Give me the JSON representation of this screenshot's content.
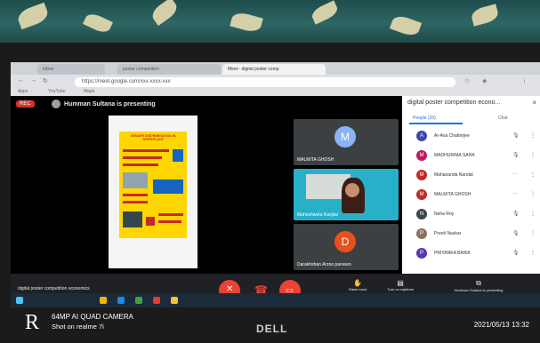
{
  "browser": {
    "tabs": [
      "Inbox",
      "poster competition",
      "Meet - digital poster comp"
    ],
    "address": "https://meet.google.com/xxx-xxxx-xxx",
    "bookmarks": [
      "Apps",
      "YouTube",
      "Maps"
    ]
  },
  "meet": {
    "rec_label": "REC",
    "presenting_text": "Humman Sultana is presenting",
    "meeting_name": "digital poster competition economics",
    "poster": {
      "title": "GENDER DISCRIMINATION IN WORKPLACE"
    },
    "tiles": [
      {
        "name": "MALMITA GHOSH",
        "initial": "M",
        "color": "#8ab4f8"
      },
      {
        "name": "Maheshweta Kanjilal",
        "video": true
      },
      {
        "name": "Darakhshan Arzoo parveen",
        "initial": "D",
        "color": "#e8501c"
      }
    ],
    "controls": {
      "mic_icon": "mic-off-icon",
      "end_icon": "call-end-icon",
      "cam_icon": "camera-off-icon",
      "raise_hand": "Raise hand",
      "captions": "Turn on captions",
      "present": "Humman Sultana is presenting"
    }
  },
  "sidebar": {
    "title": "digital poster competition econo...",
    "people_tab": "People (33)",
    "chat_tab": "Chat",
    "participants": [
      {
        "name": "Ar-Asa Chatterjee",
        "initial": "A",
        "color": "#3949ab",
        "status": "mic-off"
      },
      {
        "name": "MADHURIMA SAHA",
        "initial": "M",
        "color": "#c2185b",
        "status": "mic-off"
      },
      {
        "name": "Mahananda Nandal",
        "initial": "M",
        "color": "#c62828",
        "status": "more"
      },
      {
        "name": "MALMITA GHOSH",
        "initial": "M",
        "color": "#c62828",
        "status": "more"
      },
      {
        "name": "Neha Roy",
        "initial": "N",
        "color": "#37474f",
        "status": "mic-off"
      },
      {
        "name": "Preeti Naskar",
        "initial": "P",
        "color": "#8d6e63",
        "status": "mic-off"
      },
      {
        "name": "PRIYANKA BANIK",
        "initial": "P",
        "color": "#5e35b1",
        "status": "mic-off"
      }
    ]
  },
  "camera_stamp": {
    "line1": "64MP AI QUAD CAMERA",
    "line2": "Shot on realme 7i",
    "brand_mark": "R"
  },
  "laptop_brand": "DELL",
  "datetime": "2021/05/13 13:32"
}
